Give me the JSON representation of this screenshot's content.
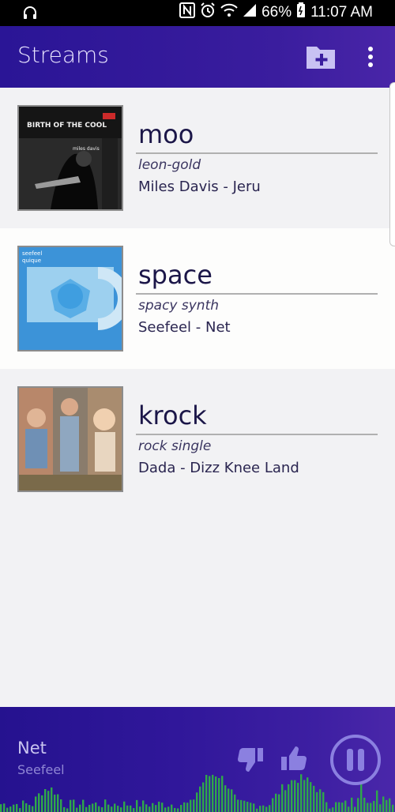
{
  "status_bar": {
    "battery_percent": "66%",
    "time": "11:07 AM",
    "icons": [
      "headphones-icon",
      "nfc-icon",
      "alarm-icon",
      "wifi-icon",
      "signal-icon",
      "battery-icon"
    ]
  },
  "app_bar": {
    "title": "Streams",
    "actions": [
      "add-folder-icon",
      "more-vert-icon"
    ]
  },
  "streams": [
    {
      "name": "moo",
      "tag": "leon-gold",
      "track": "Miles Davis - Jeru",
      "cover_text_1": "BIRTH OF THE COOL",
      "cover_text_2": "miles davis"
    },
    {
      "name": "space",
      "tag": "spacy synth",
      "track": "Seefeel - Net",
      "cover_text_1": "seefeel",
      "cover_text_2": "quique"
    },
    {
      "name": "krock",
      "tag": "rock single",
      "track": "Dada - Dizz Knee Land",
      "cover_text_1": "",
      "cover_text_2": ""
    }
  ],
  "player": {
    "title": "Net",
    "artist": "Seefeel",
    "controls": [
      "thumbs-down-icon",
      "thumbs-up-icon",
      "pause-icon"
    ]
  },
  "colors": {
    "primary": "#2a1596",
    "accent": "#8b80e0",
    "visualizer": "#2fa84a",
    "background": "#f2f2f4"
  }
}
